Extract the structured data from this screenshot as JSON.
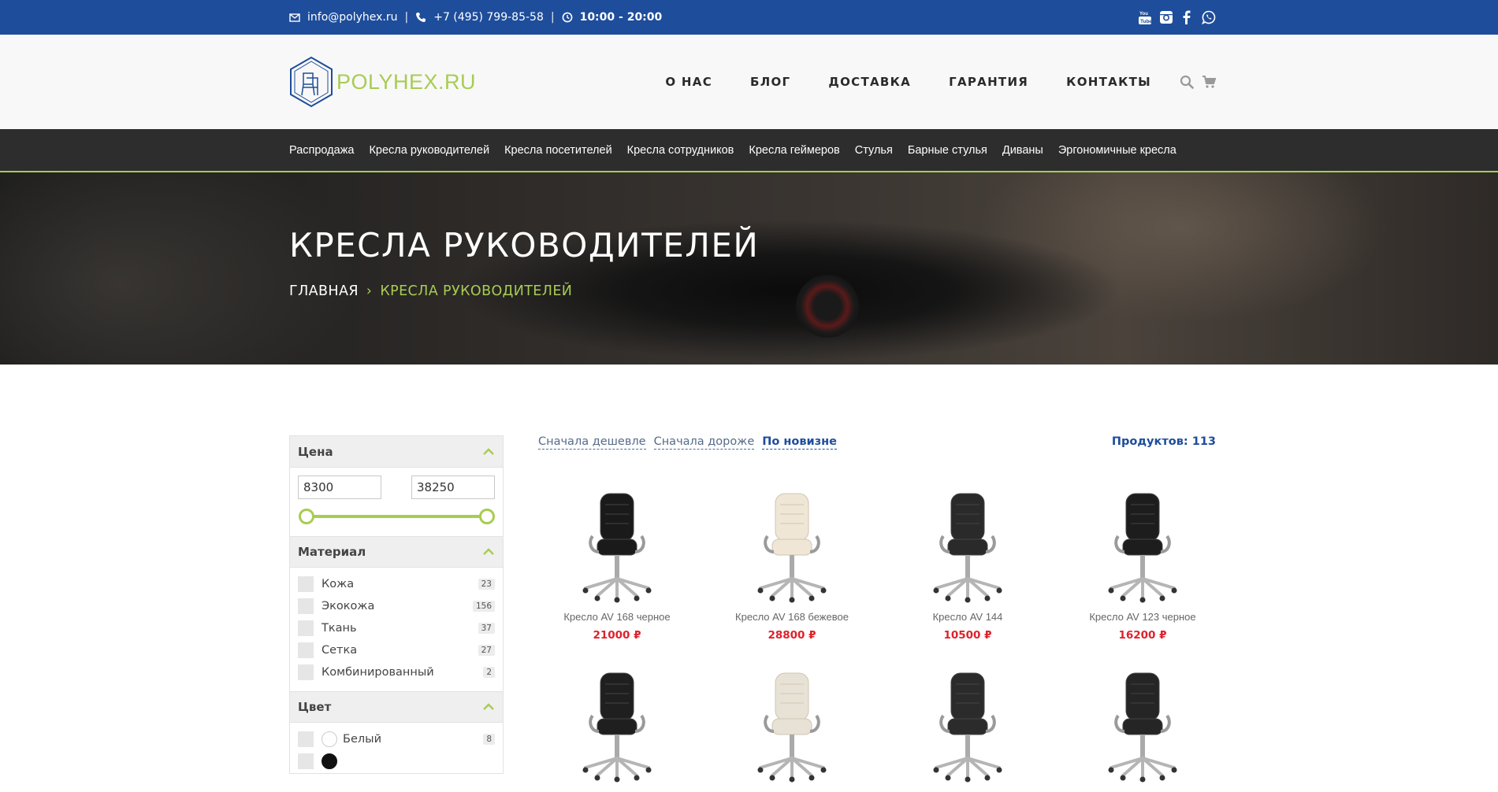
{
  "topbar": {
    "email": "info@polyhex.ru",
    "phone": "+7 (495) 799-85-58",
    "hours": "10:00 - 20:00",
    "separator": "|",
    "social": [
      "youtube-icon",
      "instagram-icon",
      "facebook-icon",
      "whatsapp-icon"
    ]
  },
  "header": {
    "logo_text": "POLYHEX.RU",
    "nav": [
      "О НАС",
      "БЛОГ",
      "ДОСТАВКА",
      "ГАРАНТИЯ",
      "КОНТАКТЫ"
    ],
    "tools": [
      "search-icon",
      "cart-icon"
    ]
  },
  "categories": [
    "Распродажа",
    "Кресла руководителей",
    "Кресла посетителей",
    "Кресла сотрудников",
    "Кресла геймеров",
    "Стулья",
    "Барные стулья",
    "Диваны",
    "Эргономичные кресла"
  ],
  "hero": {
    "title": "КРЕСЛА РУКОВОДИТЕЛЕЙ",
    "breadcrumb_home": "ГЛАВНАЯ",
    "breadcrumb_sep": "›",
    "breadcrumb_current": "КРЕСЛА РУКОВОДИТЕЛЕЙ"
  },
  "filters": {
    "price": {
      "title": "Цена",
      "min": "8300",
      "max": "38250"
    },
    "material": {
      "title": "Материал",
      "items": [
        {
          "label": "Кожа",
          "count": "23"
        },
        {
          "label": "Экокожа",
          "count": "156"
        },
        {
          "label": "Ткань",
          "count": "37"
        },
        {
          "label": "Сетка",
          "count": "27"
        },
        {
          "label": "Комбинированный",
          "count": "2"
        }
      ]
    },
    "color": {
      "title": "Цвет",
      "items": [
        {
          "label": "Белый",
          "count": "8",
          "swatch": "#ffffff"
        }
      ]
    }
  },
  "sort": {
    "options": [
      "Сначала дешевле",
      "Сначала дороже",
      "По новизне"
    ],
    "active": "По новизне"
  },
  "products_count": "Продуктов: 113",
  "products": [
    {
      "name": "Кресло AV 168 черное",
      "price": "21000 ₽",
      "color": "#1a1a1a"
    },
    {
      "name": "Кресло AV 168 бежевое",
      "price": "28800 ₽",
      "color": "#efe6d6"
    },
    {
      "name": "Кресло AV 144",
      "price": "10500 ₽",
      "color": "#2a2a2a"
    },
    {
      "name": "Кресло AV 123 черное",
      "price": "16200 ₽",
      "color": "#1d1d1d"
    },
    {
      "name": "",
      "price": "",
      "color": "#1f1f1f"
    },
    {
      "name": "",
      "price": "",
      "color": "#e8e2d6"
    },
    {
      "name": "",
      "price": "",
      "color": "#2b2b2b"
    },
    {
      "name": "",
      "price": "",
      "color": "#252525"
    }
  ]
}
